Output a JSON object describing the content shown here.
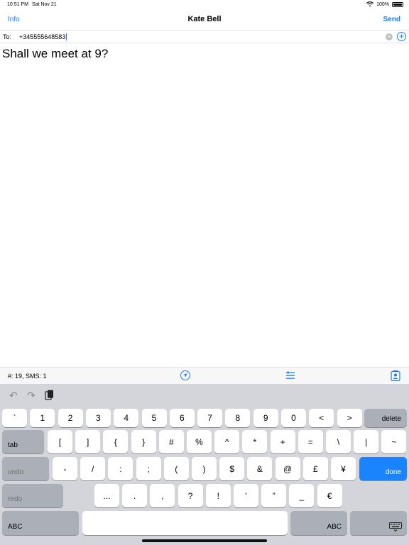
{
  "status": {
    "time": "10:51 PM",
    "date": "Sat Nov 21",
    "battery": "100%"
  },
  "nav": {
    "left": "Info",
    "title": "Kate Bell",
    "right": "Send"
  },
  "to": {
    "label": "To:",
    "value": "+345555648583",
    "clear_icon": "clear-icon",
    "add_icon": "add-contact-icon"
  },
  "message": {
    "text": "Shall we meet at 9?"
  },
  "info": {
    "counter": "#: 19, SMS: 1"
  },
  "keyboard": {
    "row1": [
      "`",
      "1",
      "2",
      "3",
      "4",
      "5",
      "6",
      "7",
      "8",
      "9",
      "0",
      "<",
      ">"
    ],
    "delete": "delete",
    "tab": "tab",
    "row2": [
      "[",
      "]",
      "{",
      "}",
      "#",
      "%",
      "^",
      "*",
      "+",
      "=",
      "\\",
      "|",
      "~"
    ],
    "undo": "undo",
    "row3": [
      "-",
      "/",
      ":",
      ";",
      "(",
      ")",
      "$",
      "&",
      "@",
      "£",
      "¥"
    ],
    "done": "done",
    "redo": "redo",
    "row4": [
      "...",
      ".",
      ",",
      "?",
      "!",
      "'",
      "”",
      "_",
      "€"
    ],
    "abc_left": "ABC",
    "abc_right": "ABC",
    "colors": {
      "accent": "#1a7bf2",
      "done_key": "#1a84ff"
    }
  }
}
